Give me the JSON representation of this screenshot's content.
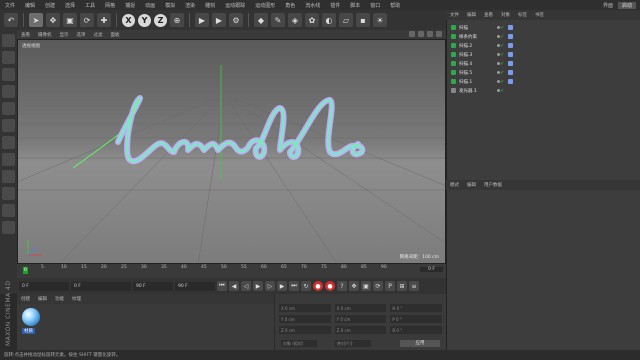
{
  "menubar": {
    "items": [
      "文件",
      "编辑",
      "创建",
      "选择",
      "工具",
      "网格",
      "捕捉",
      "动画",
      "模拟",
      "渲染",
      "雕刻",
      "运动跟踪",
      "运动图形",
      "角色",
      "流水线",
      "插件",
      "脚本",
      "窗口",
      "帮助"
    ],
    "interface_label": "界面",
    "layout_value": "启动"
  },
  "toolbar": {
    "axis_x": "X",
    "axis_y": "Y",
    "axis_z": "Z"
  },
  "viewport": {
    "menu": [
      "查看",
      "摄像机",
      "显示",
      "选项",
      "过滤",
      "面板"
    ],
    "label": "透视视图",
    "grid_distance": "网格间距：100 cm",
    "script_text": "Lamblo"
  },
  "timeline": {
    "current_frame": "0",
    "ticks": [
      "5",
      "10",
      "15",
      "20",
      "25",
      "30",
      "35",
      "40",
      "45",
      "50",
      "55",
      "60",
      "65",
      "70",
      "75",
      "80",
      "85",
      "90"
    ],
    "end_field": "0 F"
  },
  "transport": {
    "start": "0 F",
    "current": "0 F",
    "end_a": "90 F",
    "end_b": "90 F"
  },
  "material": {
    "menu": [
      "创建",
      "编辑",
      "功能",
      "纹理"
    ],
    "name": "材质",
    "brand": "MAXON CINEMA 4D"
  },
  "coords": {
    "rows": [
      [
        "X  0 cm",
        "X  0 cm",
        "H  0 °"
      ],
      [
        "Y  0 cm",
        "Y  0 cm",
        "P  0 °"
      ],
      [
        "Z  0 cm",
        "Z  0 cm",
        "B  0 °"
      ]
    ],
    "mode": "对象 (相对)",
    "size_mode": "绝对尺寸",
    "apply": "应用"
  },
  "status": {
    "text": "旋转:点击并拖动鼠标旋转元素。按住 SHIFT 键量化旋转。"
  },
  "objects": {
    "menu": [
      "文件",
      "编辑",
      "查看",
      "对象",
      "标签",
      "书签"
    ],
    "items": [
      "扫描",
      "样条约束",
      "扫描.2",
      "扫描.3",
      "扫描.4",
      "扫描.5",
      "扫描.1",
      "发光器.1"
    ]
  },
  "attributes": {
    "menu": [
      "模式",
      "编辑",
      "用户数据"
    ]
  },
  "colors": {
    "stroke_main": "#c9b8ff",
    "stroke_green": "#5dff62",
    "accent_frame": "#1ea02a"
  }
}
